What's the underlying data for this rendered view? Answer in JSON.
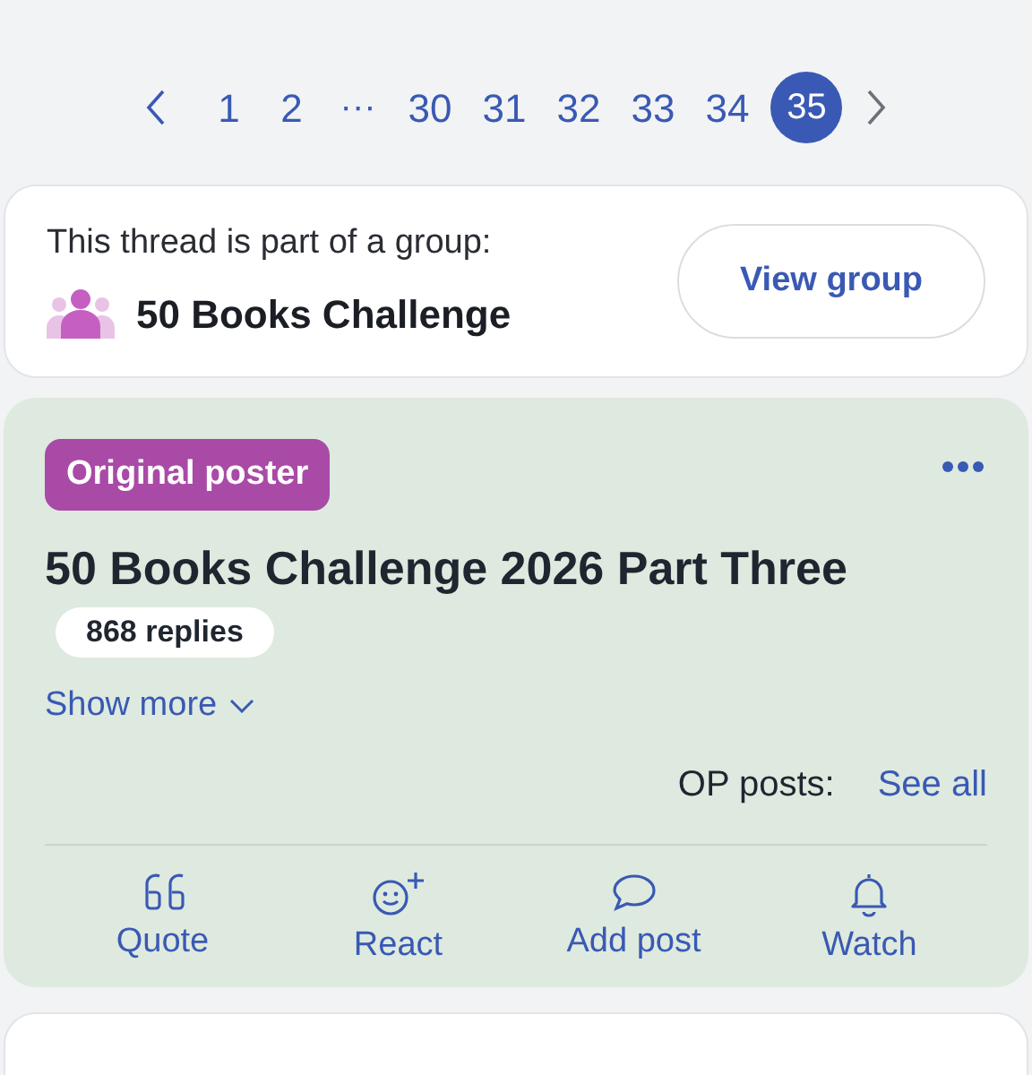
{
  "pagination": [
    {
      "kind": "prev"
    },
    {
      "kind": "page",
      "label": "1",
      "selected": false
    },
    {
      "kind": "page",
      "label": "2",
      "selected": false
    },
    {
      "kind": "ellipsis",
      "label": "···"
    },
    {
      "kind": "page",
      "label": "30",
      "selected": false
    },
    {
      "kind": "page",
      "label": "31",
      "selected": false
    },
    {
      "kind": "page",
      "label": "32",
      "selected": false
    },
    {
      "kind": "page",
      "label": "33",
      "selected": false
    },
    {
      "kind": "page",
      "label": "34",
      "selected": false
    },
    {
      "kind": "page",
      "label": "35",
      "selected": true
    },
    {
      "kind": "next"
    }
  ],
  "group_card": {
    "intro": "This thread is part of a group:",
    "group_name": "50 Books Challenge",
    "button": "View group"
  },
  "thread_card": {
    "badge": "Original poster",
    "title": "50 Books Challenge 2026 Part Three",
    "replies": "868 replies",
    "show_more": "Show more",
    "op_posts_label": "OP posts:",
    "op_posts_link": "See all",
    "actions": [
      {
        "kind": "quote",
        "label": "Quote"
      },
      {
        "kind": "react",
        "label": "React"
      },
      {
        "kind": "reply",
        "label": "Add post"
      },
      {
        "kind": "watch",
        "label": "Watch"
      }
    ]
  }
}
